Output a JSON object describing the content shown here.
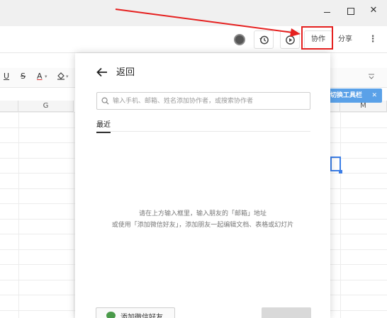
{
  "window": {
    "minimize_glyph": "",
    "maximize_glyph": "",
    "close_glyph": "✕"
  },
  "toolbar": {
    "avatar_icon": "user-avatar-icon",
    "history_icon": "history-icon",
    "play_icon": "play-icon",
    "collaborate_label": "协作",
    "share_label": "分享",
    "more_glyph": "⋮"
  },
  "annotation": {
    "arrow_color": "#e5201f",
    "highlight_color": "#e5201f"
  },
  "format_bar": {
    "underline": "U",
    "strikethrough": "S",
    "font_color": "A",
    "dropdown": "▾",
    "fill_icon": "⛭",
    "collapse": "⩡"
  },
  "sheet": {
    "columns": [
      "G",
      "M"
    ],
    "toggle_toolbar_tip": "切换工具栏",
    "tip_close": "✕",
    "accent": "#3c7ee6"
  },
  "panel": {
    "back_label": "返回",
    "search_placeholder": "输入手机、邮箱、姓名添加协作者，或搜索协作者",
    "tab_recent": "最近",
    "hint_line1": "请在上方输入框里，输入朋友的「邮箱」地址",
    "hint_line2": "或使用「添加微信好友」，添加朋友一起编辑文档、表格或幻灯片",
    "add_wechat_label": "添加微信好友"
  }
}
